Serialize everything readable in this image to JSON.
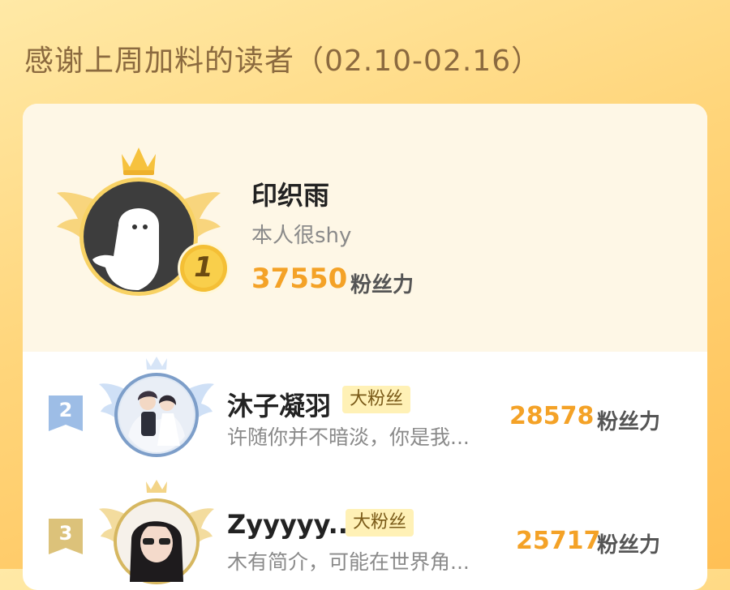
{
  "page": {
    "title": "感谢上周加料的读者（02.10-02.16）"
  },
  "top_reader": {
    "rank": "1",
    "name": "印织雨",
    "bio": "本人很shy",
    "score": "37550",
    "unit": "粉丝力"
  },
  "readers": [
    {
      "rank": "2",
      "name": "沐子凝羽",
      "badge": "大粉丝",
      "bio": "许随你并不暗淡，你是我...",
      "score": "28578",
      "unit": "粉丝力"
    },
    {
      "rank": "3",
      "name": "Zyyyyy...",
      "badge": "大粉丝",
      "bio": "木有简介，可能在世界角...",
      "score": "25717",
      "unit": "粉丝力"
    }
  ],
  "colors": {
    "accent": "#f4a227",
    "background": "#ffd57a",
    "badge_bg": "#fff1b6",
    "silver": "#8fb3e0",
    "bronze": "#e2c37a"
  },
  "icons": [
    "crown-icon",
    "wings-icon",
    "rank-medal-icon",
    "rank-flag-icon",
    "default-avatar-icon"
  ]
}
